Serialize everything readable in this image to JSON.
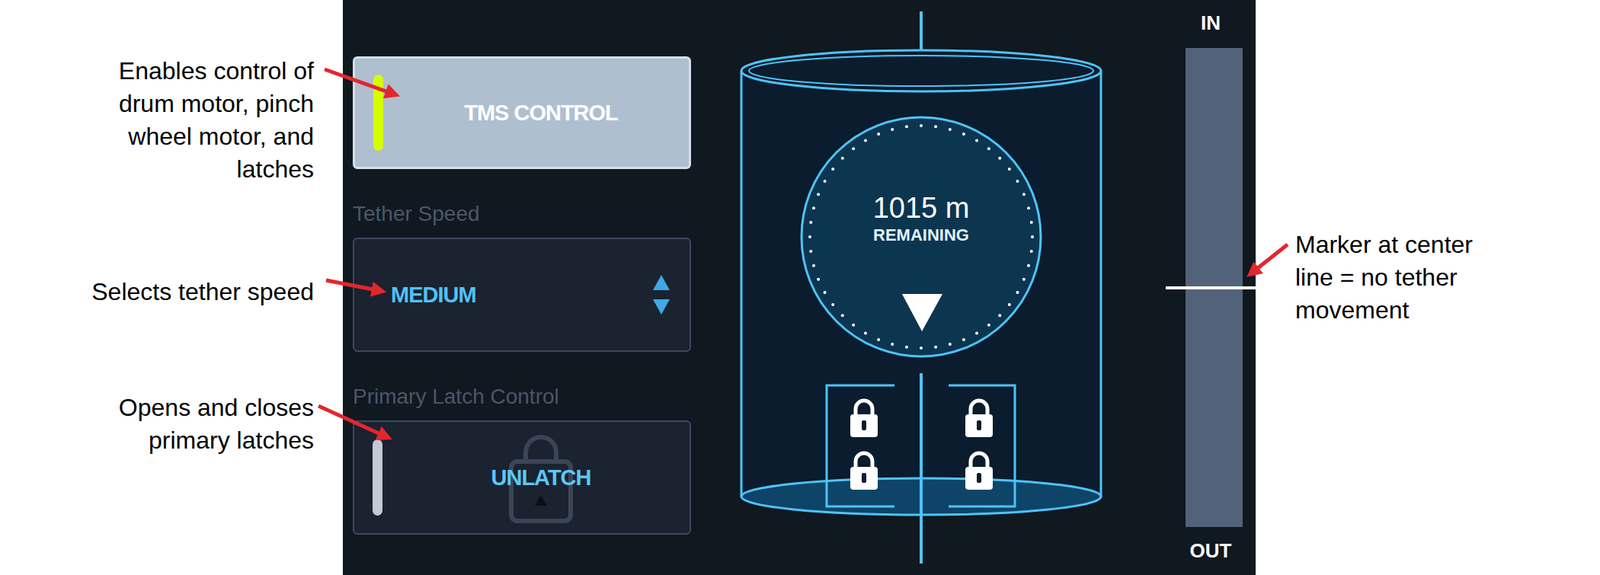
{
  "annotations": {
    "left": [
      {
        "lines": [
          "Enables control of",
          "drum motor, pinch",
          "wheel motor, and",
          "latches"
        ]
      },
      {
        "lines": [
          "Selects tether speed"
        ]
      },
      {
        "lines": [
          "Opens and closes",
          "primary latches"
        ]
      }
    ],
    "right": [
      {
        "lines": [
          "Marker at center",
          "line = no tether",
          "movement"
        ]
      }
    ]
  },
  "tms_control": {
    "label": "TMS CONTROL",
    "on": true
  },
  "tether_speed": {
    "label": "Tether Speed",
    "value": "MEDIUM"
  },
  "primary_latch": {
    "label": "Primary Latch Control",
    "button": "UNLATCH",
    "on": false
  },
  "drum": {
    "remaining_value": "1015 m",
    "remaining_label": "REMAINING",
    "latches": [
      {
        "locked": true
      },
      {
        "locked": true
      },
      {
        "locked": true
      },
      {
        "locked": true
      }
    ]
  },
  "tether_slider": {
    "top_label": "IN",
    "bottom_label": "OUT",
    "level": 0.5
  }
}
